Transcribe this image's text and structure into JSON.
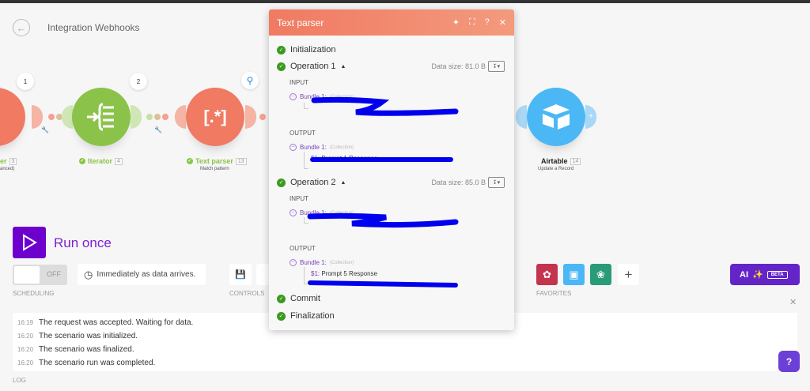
{
  "header": {
    "title": "Integration Webhooks"
  },
  "modules": [
    {
      "name_partial": "er",
      "number": "3",
      "subtitle_partial": "anced)",
      "bubble": "1"
    },
    {
      "name": "Iterator",
      "number": "4",
      "bubble": "2"
    },
    {
      "name": "Text parser",
      "number": "13",
      "subtitle": "Match pattern"
    },
    {
      "name": "Airtable",
      "number": "14",
      "subtitle": "Update a Record"
    }
  ],
  "panel": {
    "title": "Text parser",
    "initialization": "Initialization",
    "operations": [
      {
        "label": "Operation 1",
        "data_size": "Data size: 81.0 B",
        "input_label": "INPUT",
        "output_label": "OUTPUT",
        "input_bundle": "Bundle 1:",
        "input_collection": "(Collection)",
        "output_bundle": "Bundle 1:",
        "output_collection": "(Collection)",
        "output_key": "$1:",
        "output_value": "Prompt 1 Response"
      },
      {
        "label": "Operation 2",
        "data_size": "Data size: 85.0 B",
        "input_label": "INPUT",
        "output_label": "OUTPUT",
        "input_bundle": "Bundle 1:",
        "input_collection": "(Collection)",
        "output_bundle": "Bundle 1:",
        "output_collection": "(Collection)",
        "output_key": "$1:",
        "output_value": "Prompt 5 Response"
      }
    ],
    "commit": "Commit",
    "finalization": "Finalization"
  },
  "run": {
    "label": "Run once"
  },
  "scheduling": {
    "toggle": "OFF",
    "schedule": "Immediately as data arrives.",
    "caption": "SCHEDULING"
  },
  "controls": {
    "caption": "CONTROLS"
  },
  "favorites": {
    "caption": "FAVORITES"
  },
  "ai": {
    "label": "AI",
    "badge": "BETA"
  },
  "log": {
    "caption": "LOG",
    "entries": [
      {
        "time": "16:19",
        "text": "The request was accepted. Waiting for data."
      },
      {
        "time": "16:20",
        "text": "The scenario was initialized."
      },
      {
        "time": "16:20",
        "text": "The scenario was finalized."
      },
      {
        "time": "16:20",
        "text": "The scenario run was completed."
      }
    ]
  },
  "colors": {
    "accent": "#6d00cc",
    "parser": "#f07a62",
    "iterator": "#8bc34a",
    "airtable": "#4bb8f5",
    "ai": "#6325c8"
  }
}
